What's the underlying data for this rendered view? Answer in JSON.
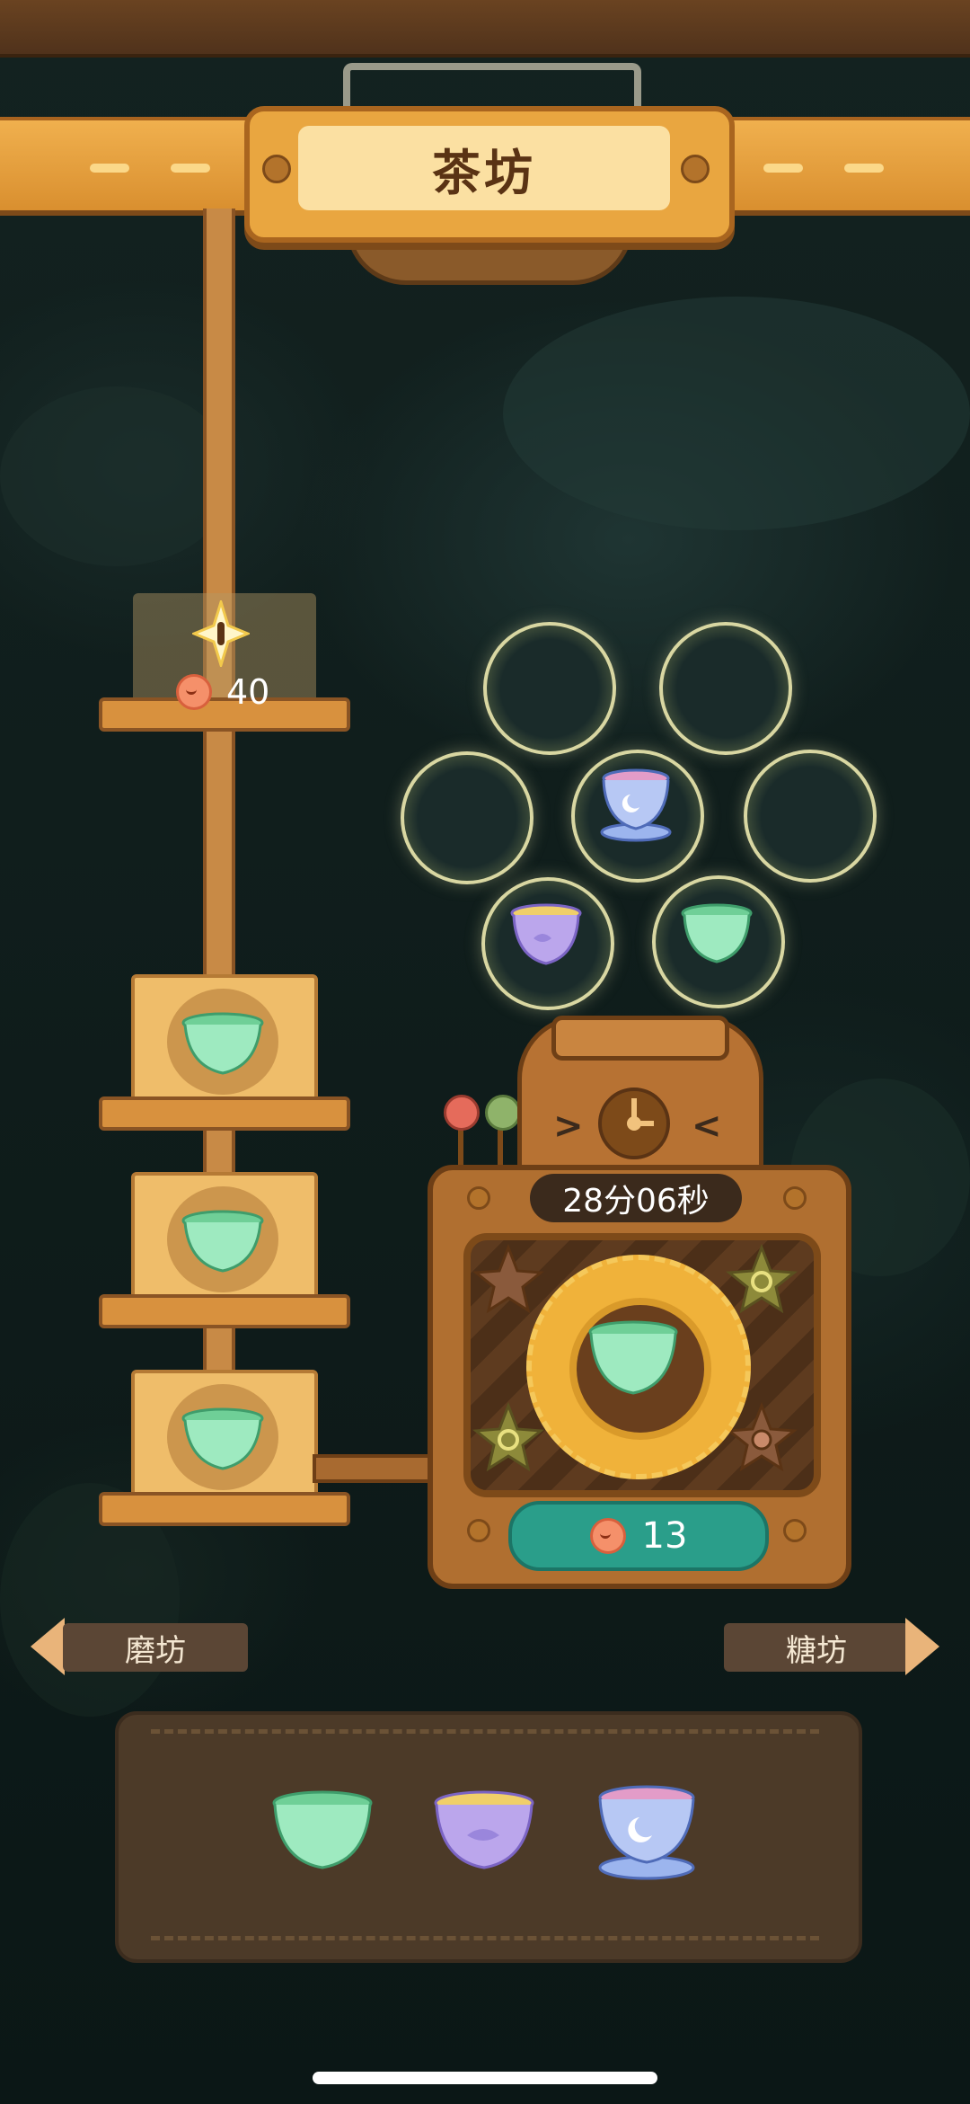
{
  "header": {
    "title": "茶坊"
  },
  "unlock": {
    "cost": "40"
  },
  "machine": {
    "timer": "28分06秒",
    "speedup_cost": "13"
  },
  "nav": {
    "left_label": "磨坊",
    "right_label": "糖坊"
  },
  "colors": {
    "accent_wood": "#d98f2f",
    "cost_button": "#2a9e8a",
    "cup_green": "#8ee0b0",
    "cup_purple": "#b8a2e8",
    "cup_blue": "#9cb5ee"
  },
  "products": [
    "green-tea-cup",
    "green-tea-cup",
    "green-tea-cup"
  ],
  "bubbles": [
    "empty",
    "empty",
    "empty",
    "moon-tea-cup",
    "empty",
    "purple-tea-cup",
    "green-tea-cup"
  ],
  "tray_items": [
    "green-tea-cup",
    "purple-tea-cup",
    "moon-tea-cup"
  ]
}
